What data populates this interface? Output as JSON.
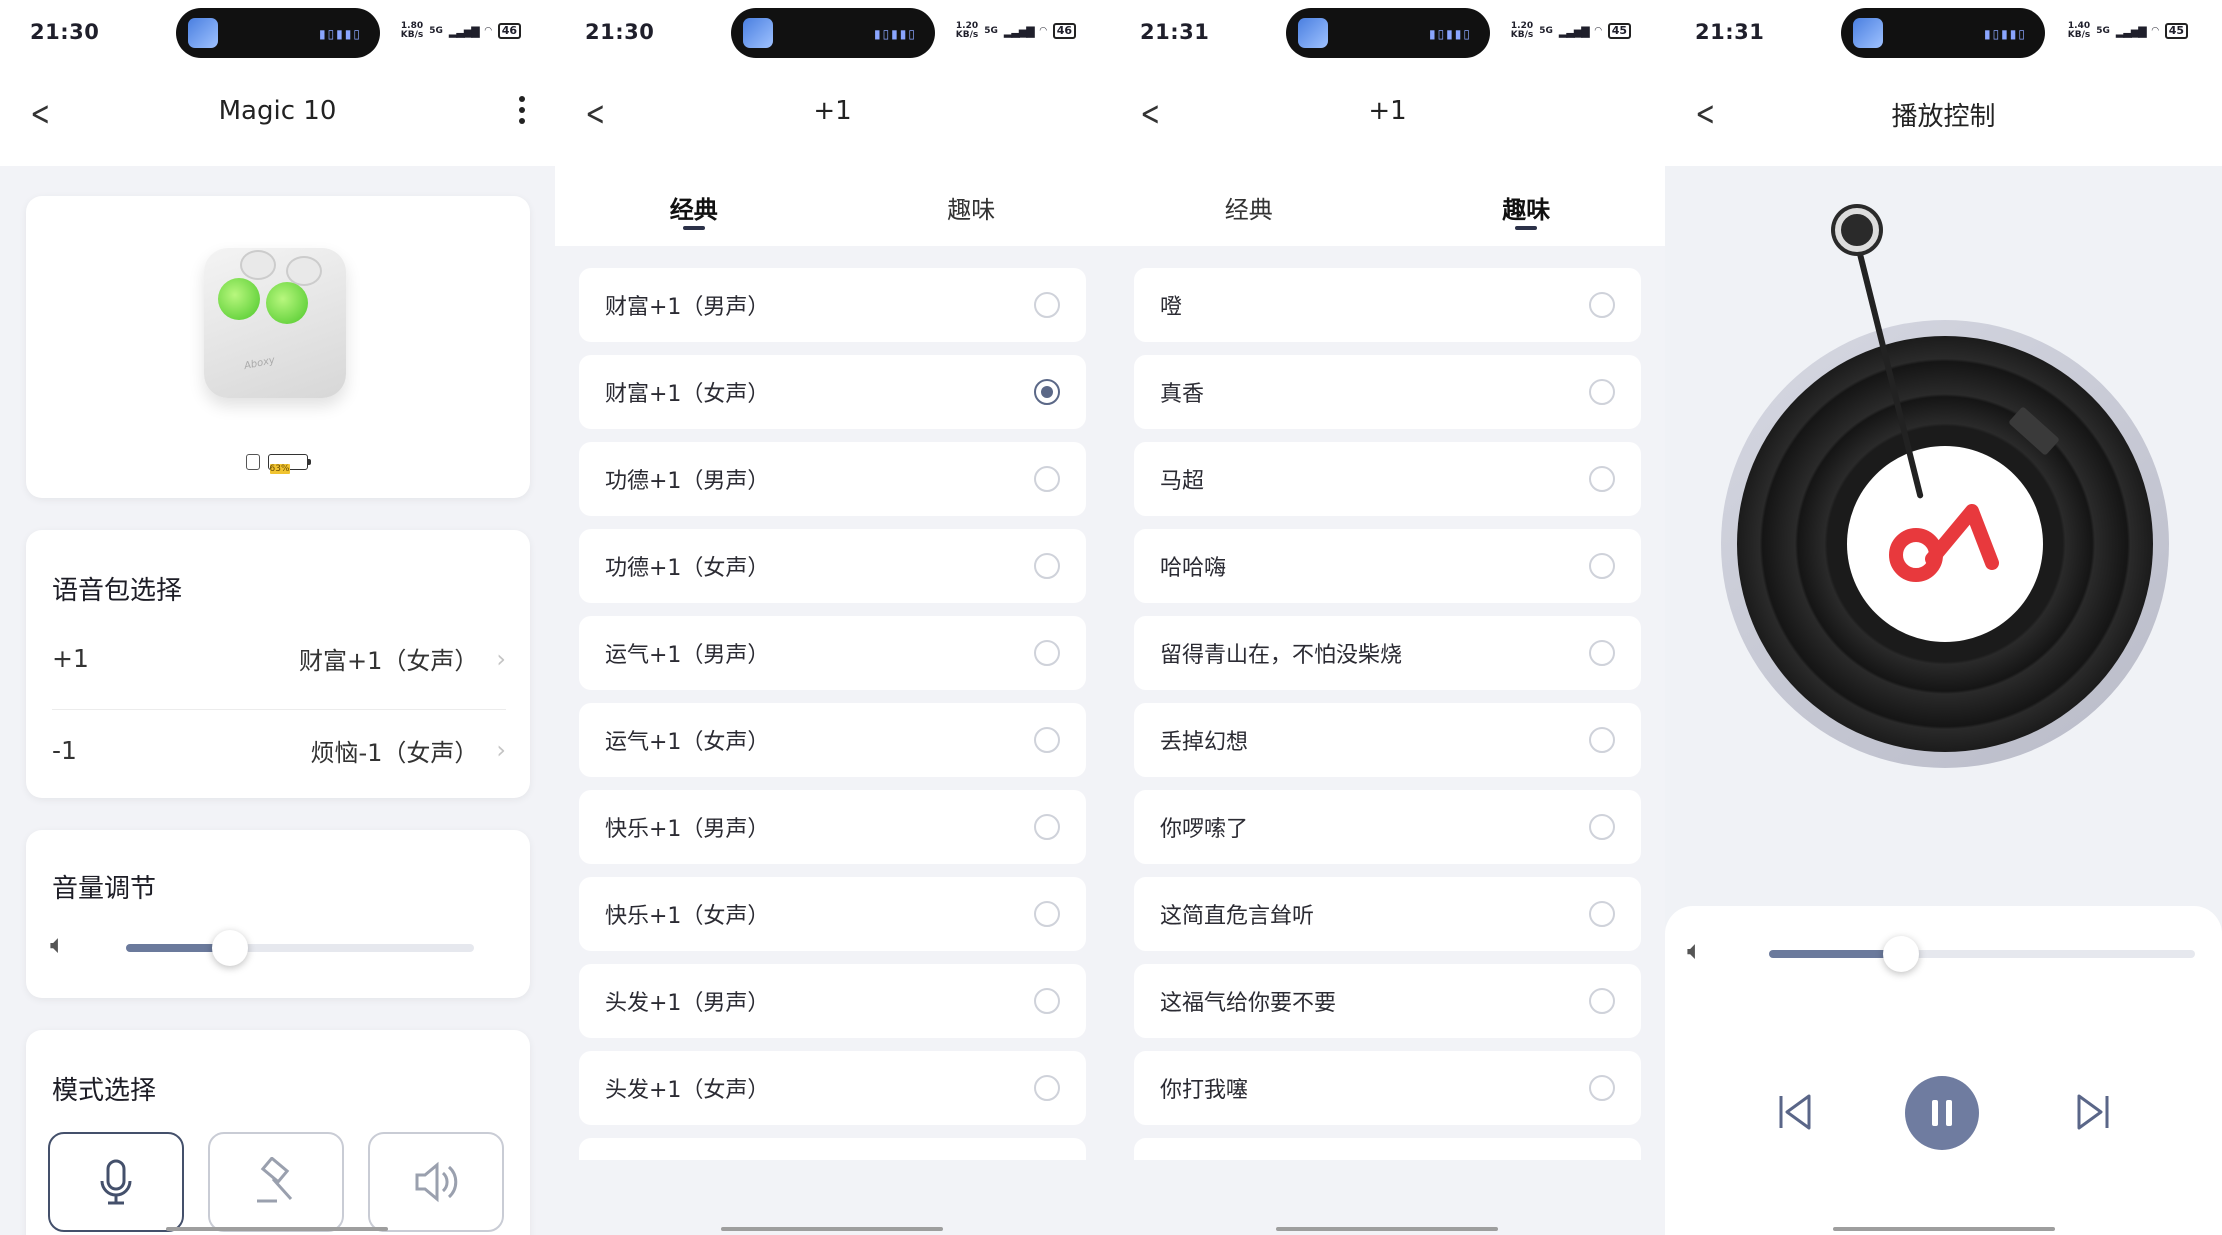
{
  "screens": [
    {
      "status": {
        "time": "21:30",
        "speed_val": "1.80",
        "speed_unit": "KB/s",
        "network": "5G",
        "battery": "46"
      },
      "nav": {
        "title": "Magic 10"
      },
      "device": {
        "case_battery": "63%"
      },
      "voice_pack": {
        "title": "语音包选择",
        "rows": [
          {
            "key": "+1",
            "value": "财富+1（女声）"
          },
          {
            "key": "-1",
            "value": "烦恼-1（女声）"
          }
        ]
      },
      "volume": {
        "title": "音量调节",
        "level": 0.3
      },
      "mode": {
        "title": "模式选择",
        "icons": [
          "microphone-icon",
          "gavel-icon",
          "speaker-icon"
        ]
      }
    },
    {
      "status": {
        "time": "21:30",
        "speed_val": "1.20",
        "speed_unit": "KB/s",
        "network": "5G",
        "battery": "46"
      },
      "nav": {
        "title": "+1"
      },
      "tabs": [
        "经典",
        "趣味"
      ],
      "active_tab": 0,
      "items": [
        "财富+1（男声）",
        "财富+1（女声）",
        "功德+1（男声）",
        "功德+1（女声）",
        "运气+1（男声）",
        "运气+1（女声）",
        "快乐+1（男声）",
        "快乐+1（女声）",
        "头发+1（男声）",
        "头发+1（女声）"
      ],
      "selected": 1
    },
    {
      "status": {
        "time": "21:31",
        "speed_val": "1.20",
        "speed_unit": "KB/s",
        "network": "5G",
        "battery": "45"
      },
      "nav": {
        "title": "+1"
      },
      "tabs": [
        "经典",
        "趣味"
      ],
      "active_tab": 1,
      "items": [
        "噔",
        "真香",
        "马超",
        "哈哈嗨",
        "留得青山在，不怕没柴烧",
        "丢掉幻想",
        "你啰嗦了",
        "这简直危言耸听",
        "这福气给你要不要",
        "你打我噻"
      ]
    },
    {
      "status": {
        "time": "21:31",
        "speed_val": "1.40",
        "speed_unit": "KB/s",
        "network": "5G",
        "battery": "45"
      },
      "nav": {
        "title": "播放控制"
      },
      "volume": {
        "level": 0.31
      },
      "controls": {
        "prev": "skip-previous-icon",
        "play": "pause-icon",
        "next": "skip-next-icon"
      }
    }
  ],
  "colors": {
    "accent": "#6f7ca0",
    "logo_red": "#e8393d",
    "earbud_green": "#5fd33a",
    "battery_yellow": "#f0c330"
  }
}
